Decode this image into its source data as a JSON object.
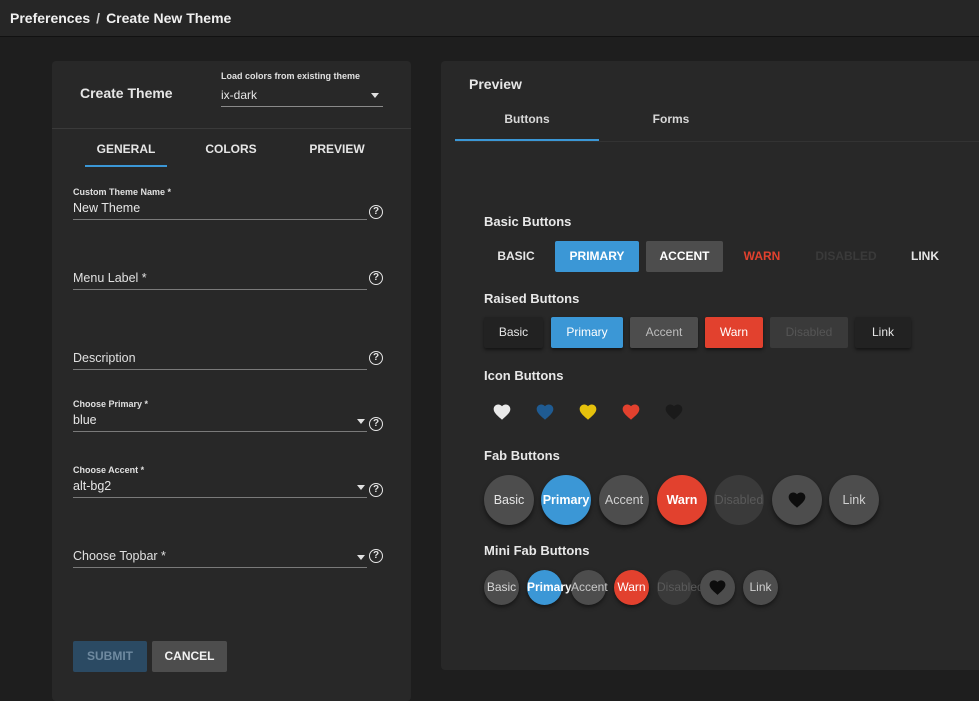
{
  "breadcrumb": {
    "parent": "Preferences",
    "separator": "/",
    "current": "Create New Theme"
  },
  "form_card": {
    "title": "Create Theme",
    "load_colors": {
      "label": "Load colors from existing theme",
      "value": "ix-dark"
    },
    "tabs": [
      {
        "label": "GENERAL",
        "active": true
      },
      {
        "label": "COLORS",
        "active": false
      },
      {
        "label": "PREVIEW",
        "active": false
      }
    ],
    "fields": {
      "custom_theme_name": {
        "label": "Custom Theme Name *",
        "value": "New Theme"
      },
      "menu_label": {
        "placeholder": "Menu Label *"
      },
      "description": {
        "placeholder": "Description"
      },
      "choose_primary": {
        "label": "Choose Primary *",
        "value": "blue"
      },
      "choose_accent": {
        "label": "Choose Accent *",
        "value": "alt-bg2"
      },
      "choose_topbar": {
        "placeholder": "Choose Topbar *"
      }
    },
    "help_glyph": "?",
    "submit_label": "SUBMIT",
    "cancel_label": "CANCEL"
  },
  "preview_card": {
    "title": "Preview",
    "tabs": [
      {
        "label": "Buttons",
        "active": true
      },
      {
        "label": "Forms",
        "active": false
      }
    ],
    "basic": {
      "title": "Basic Buttons",
      "basic": "BASIC",
      "primary": "PRIMARY",
      "accent": "ACCENT",
      "warn": "WARN",
      "disabled": "DISABLED",
      "link": "LINK"
    },
    "raised": {
      "title": "Raised Buttons",
      "basic": "Basic",
      "primary": "Primary",
      "accent": "Accent",
      "warn": "Warn",
      "disabled": "Disabled",
      "link": "Link"
    },
    "icon": {
      "title": "Icon Buttons"
    },
    "fab": {
      "title": "Fab Buttons",
      "basic": "Basic",
      "primary": "Primary",
      "accent": "Accent",
      "warn": "Warn",
      "disabled": "Disabled",
      "link": "Link"
    },
    "mini_fab": {
      "title": "Mini Fab Buttons",
      "basic": "Basic",
      "primary": "Primary",
      "accent": "Accent",
      "warn": "Warn",
      "disabled": "Disabled",
      "link": "Link"
    }
  },
  "colors": {
    "primary": "#3b97d6",
    "warn": "#e2412e",
    "accent": "#4d4d4d",
    "yellow": "#e5c10c",
    "heart_white": "#eaeaea",
    "heart_blue": "#1f5b92",
    "heart_black": "#1a1a1a"
  }
}
